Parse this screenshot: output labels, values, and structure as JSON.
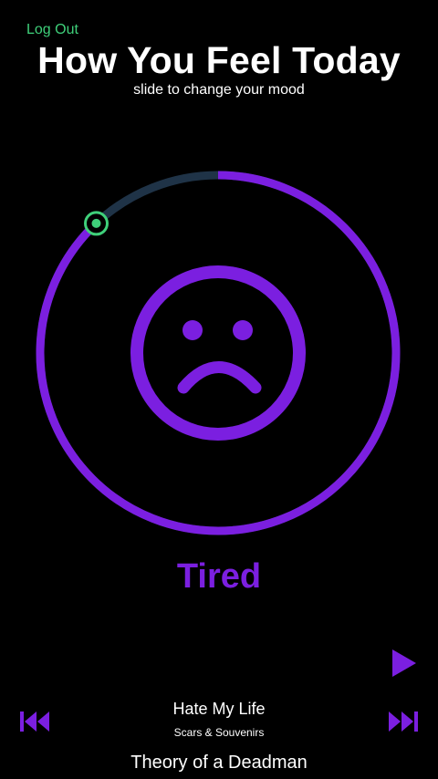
{
  "header": {
    "logout_label": "Log Out",
    "title": "How You Feel Today",
    "subtitle": "slide to change your mood"
  },
  "mood": {
    "label": "Tired",
    "face": "sad-face-icon",
    "slider_level_percent": 88
  },
  "player": {
    "song_title": "Hate My Life",
    "album": "Scars & Souvenirs",
    "artist": "Theory of a Deadman",
    "play_icon": "play-icon",
    "prev_icon": "skip-back-icon",
    "next_icon": "skip-forward-icon"
  },
  "colors": {
    "accent": "#7b1fe0",
    "track_remaining": "#1f3347",
    "handle": "#3fd07a",
    "logout": "#3fd07a",
    "background": "#000000",
    "text": "#ffffff"
  }
}
